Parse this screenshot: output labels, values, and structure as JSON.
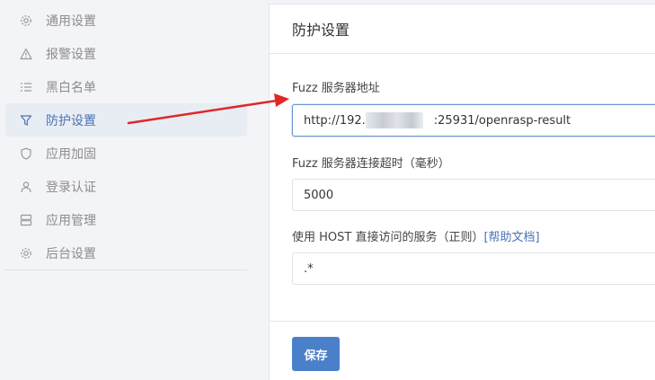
{
  "sidebar": {
    "items": [
      {
        "label": "通用设置",
        "icon": "gear-icon",
        "active": false
      },
      {
        "label": "报警设置",
        "icon": "warning-icon",
        "active": false
      },
      {
        "label": "黑白名单",
        "icon": "list-icon",
        "active": false
      },
      {
        "label": "防护设置",
        "icon": "filter-icon",
        "active": true
      },
      {
        "label": "应用加固",
        "icon": "shield-icon",
        "active": false
      },
      {
        "label": "登录认证",
        "icon": "user-icon",
        "active": false
      },
      {
        "label": "应用管理",
        "icon": "server-icon",
        "active": false
      },
      {
        "label": "后台设置",
        "icon": "gear-icon",
        "active": false
      }
    ]
  },
  "main": {
    "title": "防护设置",
    "fields": {
      "fuzz_server": {
        "label": "Fuzz 服务器地址",
        "value_prefix": "http://192.",
        "value_suffix": ":25931/openrasp-result"
      },
      "fuzz_timeout": {
        "label": "Fuzz 服务器连接超时（毫秒）",
        "value": "5000"
      },
      "host_regex": {
        "label": "使用 HOST 直接访问的服务（正则）",
        "help_link": "[帮助文档]",
        "value": ".*"
      }
    },
    "save_label": "保存"
  },
  "colors": {
    "accent": "#4a7fc9",
    "active_text": "#4a73b8",
    "active_bg": "#e8edf4",
    "annotation_arrow": "#e0282a"
  }
}
